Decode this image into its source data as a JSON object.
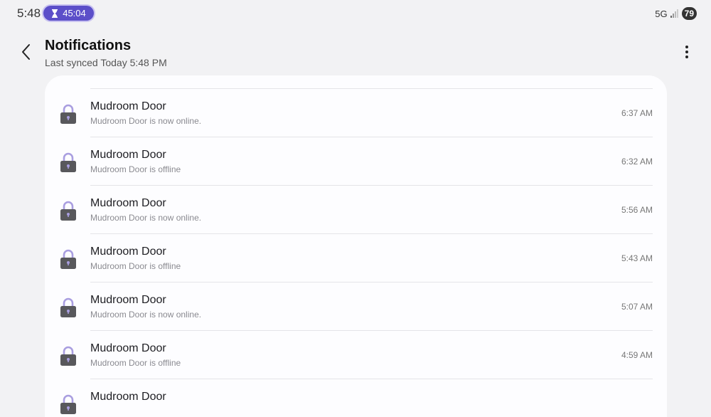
{
  "status_bar": {
    "time": "5:48",
    "timer": "45:04",
    "network": "5G",
    "battery": "79"
  },
  "header": {
    "title": "Notifications",
    "subtitle": "Last synced Today 5:48 PM"
  },
  "notifications": [
    {
      "title": "Mudroom Door",
      "message": "Mudroom Door is now online.",
      "time": "6:37 AM"
    },
    {
      "title": "Mudroom Door",
      "message": "Mudroom Door is offline",
      "time": "6:32 AM"
    },
    {
      "title": "Mudroom Door",
      "message": "Mudroom Door is now online.",
      "time": "5:56 AM"
    },
    {
      "title": "Mudroom Door",
      "message": "Mudroom Door is offline",
      "time": "5:43 AM"
    },
    {
      "title": "Mudroom Door",
      "message": "Mudroom Door is now online.",
      "time": "5:07 AM"
    },
    {
      "title": "Mudroom Door",
      "message": "Mudroom Door is offline",
      "time": "4:59 AM"
    },
    {
      "title": "Mudroom Door",
      "message": "",
      "time": ""
    }
  ],
  "colors": {
    "accent": "#5c4fc9",
    "lock_body": "#58585c",
    "lock_shackle": "#a99ee0"
  }
}
